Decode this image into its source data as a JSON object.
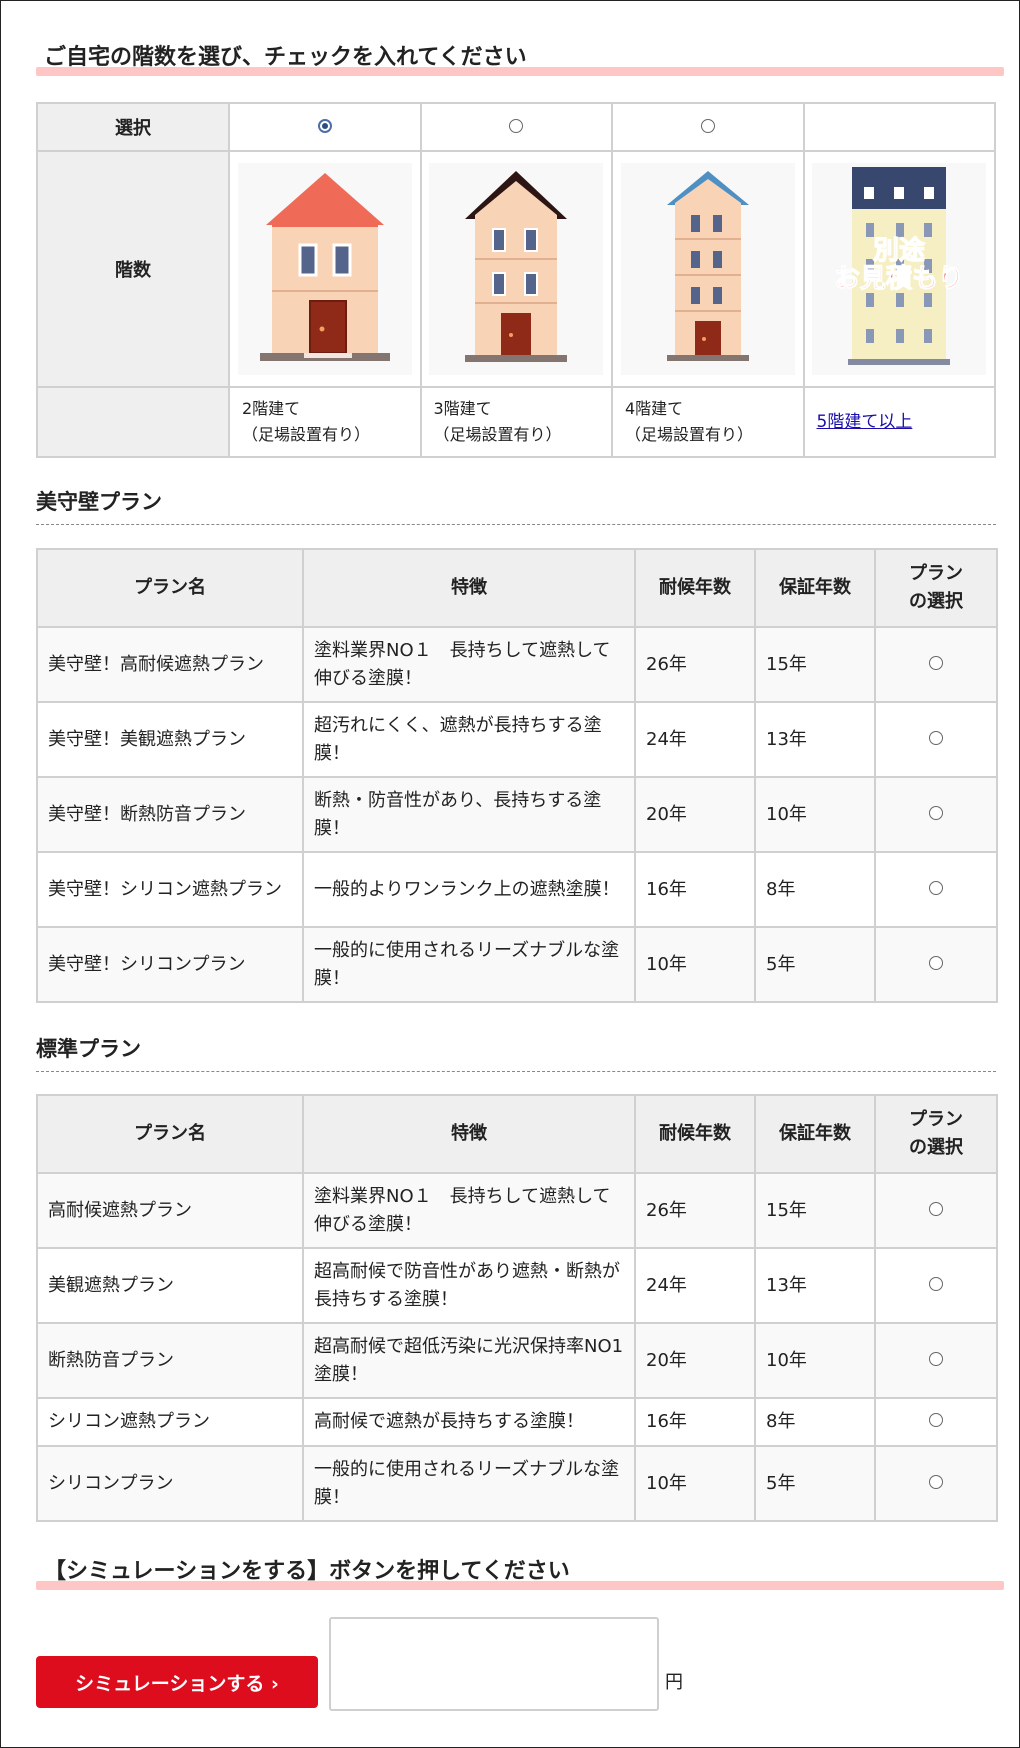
{
  "floor_section": {
    "heading": "ご自宅の階数を選び、チェックを入れてください",
    "select_label": "選択",
    "floors_label": "階数",
    "options": [
      {
        "caption_line1": "2階建て",
        "caption_line2": "（足場設置有り）",
        "selected": true
      },
      {
        "caption_line1": "3階建て",
        "caption_line2": "（足場設置有り）",
        "selected": false
      },
      {
        "caption_line1": "4階建て",
        "caption_line2": "（足場設置有り）",
        "selected": false
      },
      {
        "link_text": "5階建て以上",
        "image_text_line1": "別途",
        "image_text_line2": "お見積もり"
      }
    ]
  },
  "bishu_plan": {
    "heading": "美守壁プラン",
    "headers": {
      "name": "プラン名",
      "feature": "特徴",
      "durability": "耐候年数",
      "warranty": "保証年数",
      "select_line1": "プラン",
      "select_line2": "の選択"
    },
    "rows": [
      {
        "name": "美守壁！高耐候遮熱プラン",
        "feature": "塗料業界NO１　長持ちして遮熱して伸びる塗膜！",
        "durability": "26年",
        "warranty": "15年"
      },
      {
        "name": "美守壁！美観遮熱プラン",
        "feature": "超汚れにくく、遮熱が長持ちする塗膜！",
        "durability": "24年",
        "warranty": "13年"
      },
      {
        "name": "美守壁！断熱防音プラン",
        "feature": "断熱・防音性があり、長持ちする塗膜！",
        "durability": "20年",
        "warranty": "10年"
      },
      {
        "name": "美守壁！シリコン遮熱プラン",
        "feature": "一般的よりワンランク上の遮熱塗膜！",
        "durability": "16年",
        "warranty": "8年"
      },
      {
        "name": "美守壁！シリコンプラン",
        "feature": "一般的に使用されるリーズナブルな塗膜！",
        "durability": "10年",
        "warranty": "5年"
      }
    ]
  },
  "standard_plan": {
    "heading": "標準プラン",
    "headers": {
      "name": "プラン名",
      "feature": "特徴",
      "durability": "耐候年数",
      "warranty": "保証年数",
      "select_line1": "プラン",
      "select_line2": "の選択"
    },
    "rows": [
      {
        "name": "高耐候遮熱プラン",
        "feature": "塗料業界NO１　長持ちして遮熱して伸びる塗膜！",
        "durability": "26年",
        "warranty": "15年"
      },
      {
        "name": "美観遮熱プラン",
        "feature": "超高耐候で防音性があり遮熱・断熱が長持ちする塗膜！",
        "durability": "24年",
        "warranty": "13年"
      },
      {
        "name": "断熱防音プラン",
        "feature": "超高耐候で超低汚染に光沢保持率NO1塗膜！",
        "durability": "20年",
        "warranty": "10年"
      },
      {
        "name": "シリコン遮熱プラン",
        "feature": "高耐候で遮熱が長持ちする塗膜！",
        "durability": "16年",
        "warranty": "8年"
      },
      {
        "name": "シリコンプラン",
        "feature": "一般的に使用されるリーズナブルな塗膜！",
        "durability": "10年",
        "warranty": "5年"
      }
    ]
  },
  "simulation": {
    "heading": "【シミュレーションをする】ボタンを押してください",
    "button_label": "シミュレーションする ›",
    "result_value": "",
    "unit": "円"
  },
  "colors": {
    "heading_highlight": "#ffc6c6",
    "button_red": "#dd0d1e",
    "header_bg": "#efefef",
    "link_blue": "#1a0dab"
  }
}
